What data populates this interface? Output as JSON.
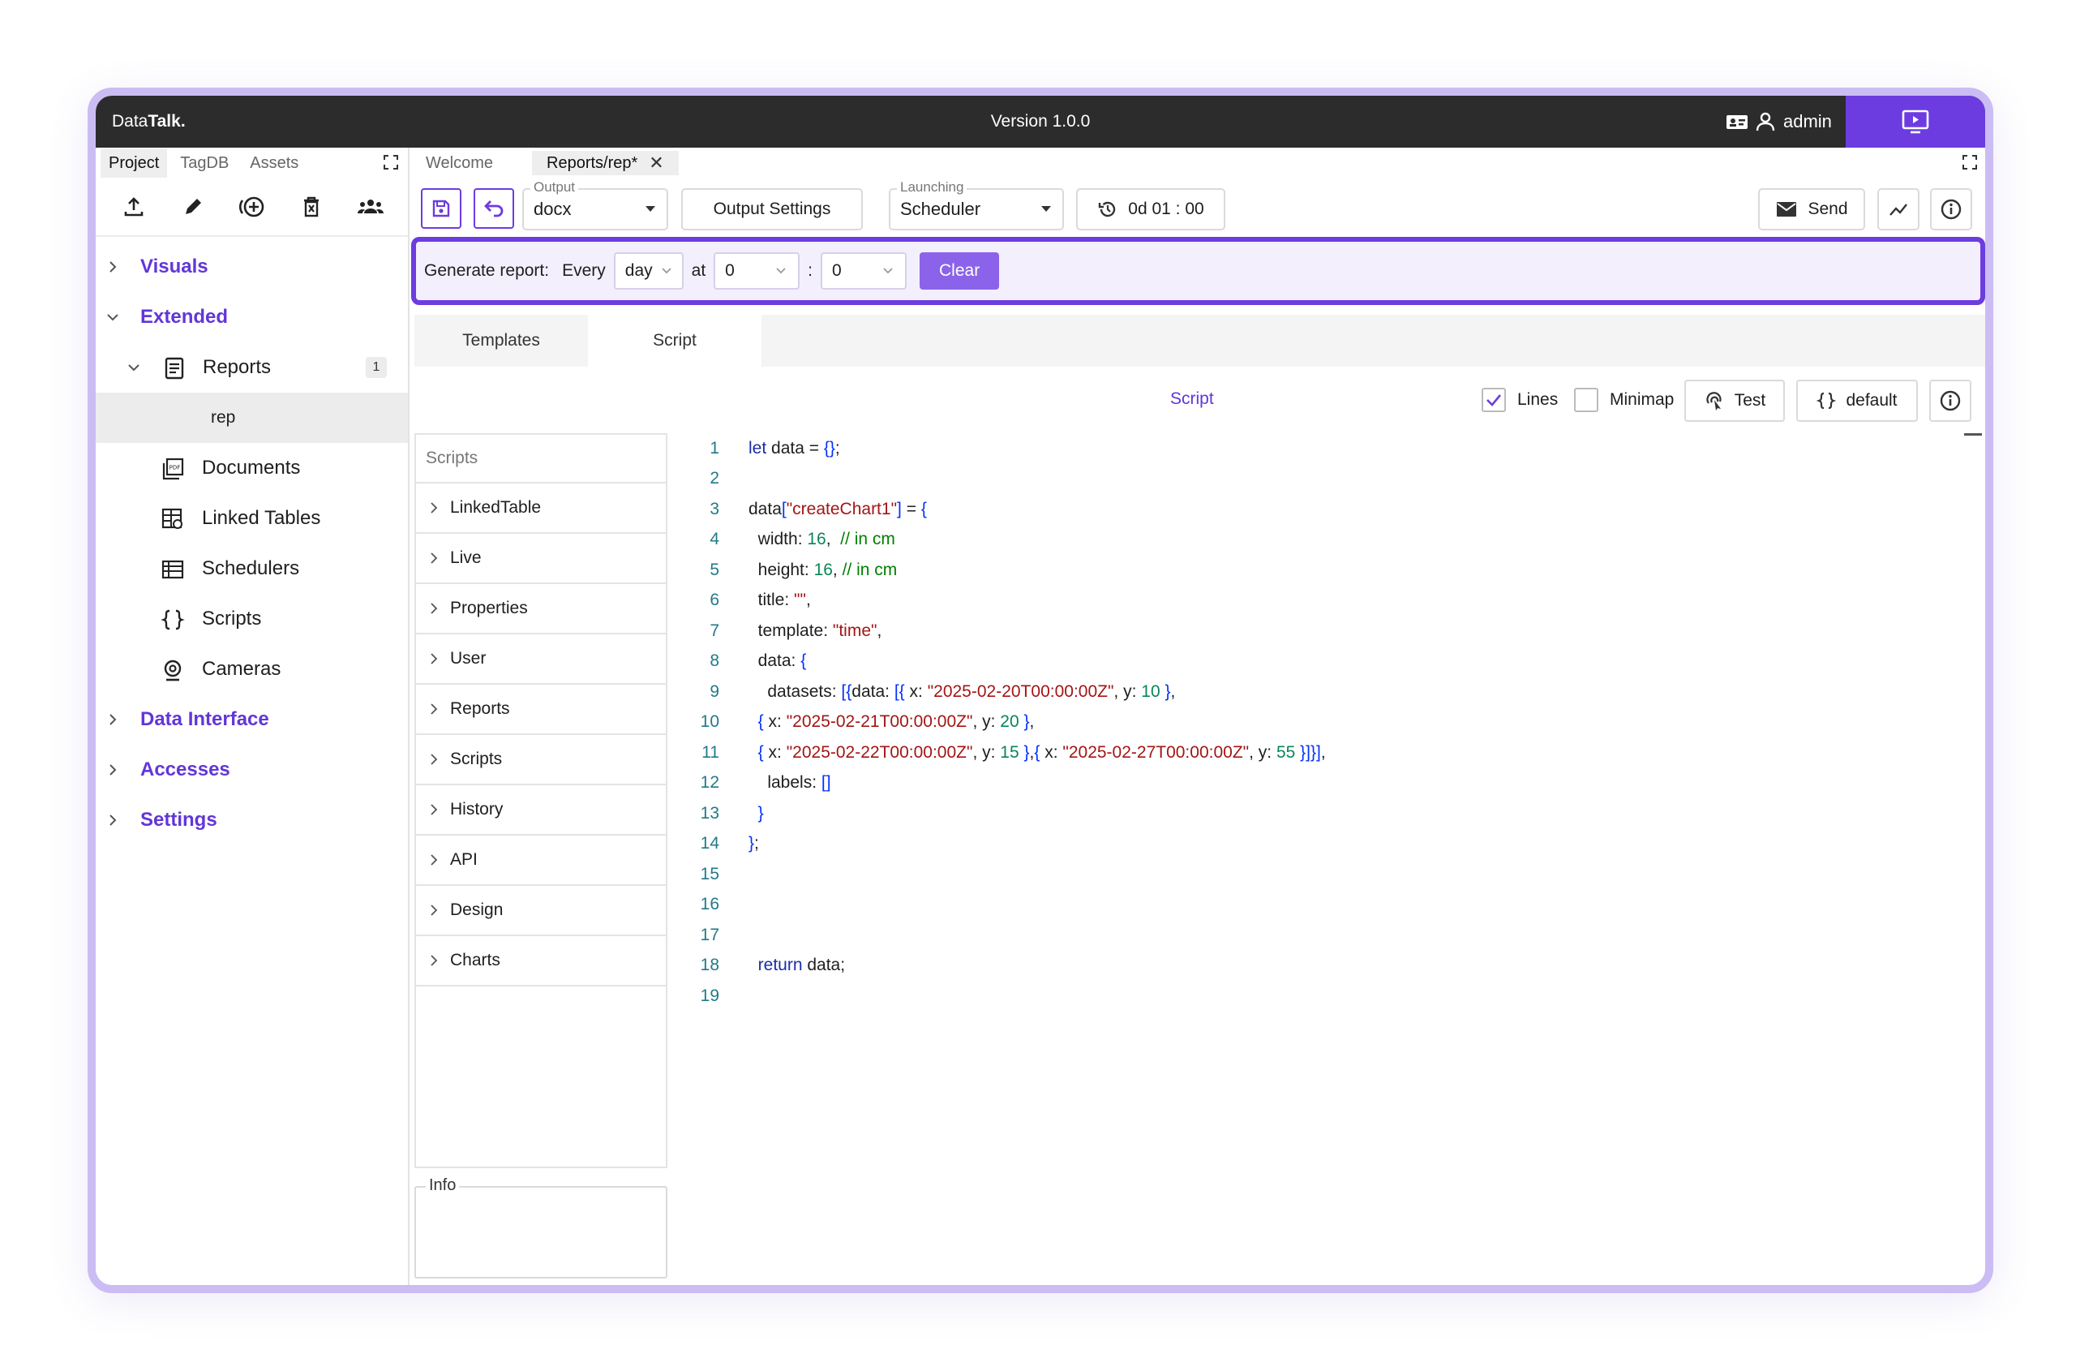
{
  "topbar": {
    "brand_light": "Data",
    "brand_bold": "Talk.",
    "version": "Version 1.0.0",
    "user": "admin",
    "accent": "#6c3ce0"
  },
  "left": {
    "tabs": [
      "Project",
      "TagDB",
      "Assets"
    ],
    "toolbar_icons": [
      "upload-icon",
      "pencil-icon",
      "add-circle-icon",
      "delete-icon",
      "group-icon"
    ],
    "tree": {
      "visuals": "Visuals",
      "extended": "Extended",
      "reports": "Reports",
      "reports_badge": "1",
      "rep": "rep",
      "documents": "Documents",
      "linked_tables": "Linked Tables",
      "schedulers": "Schedulers",
      "scripts": "Scripts",
      "cameras": "Cameras",
      "data_interface": "Data Interface",
      "accesses": "Accesses",
      "settings": "Settings"
    }
  },
  "main": {
    "tabs": {
      "welcome": "Welcome",
      "active": "Reports/rep*"
    },
    "toolbar": {
      "output_legend": "Output",
      "output_value": "docx",
      "output_settings": "Output Settings",
      "launching_legend": "Launching",
      "launching_value": "Scheduler",
      "timer": "0d 01 : 00",
      "send": "Send"
    },
    "generate": {
      "label": "Generate report:",
      "every": "Every",
      "period": "day",
      "at": "at",
      "hour": "0",
      "sep": ":",
      "minute": "0",
      "clear": "Clear"
    },
    "view_tabs": [
      "Templates",
      "Script"
    ],
    "script_header": {
      "title": "Script",
      "lines": "Lines",
      "minimap": "Minimap",
      "test": "Test",
      "default": "default"
    },
    "scripts_panel": {
      "placeholder": "Scripts",
      "items": [
        "LinkedTable",
        "Live",
        "Properties",
        "User",
        "Reports",
        "Scripts",
        "History",
        "API",
        "Design",
        "Charts"
      ],
      "info": "Info"
    },
    "editor": {
      "line_numbers": [
        "1",
        "2",
        "3",
        "4",
        "5",
        "6",
        "7",
        "8",
        "9",
        "10",
        "11",
        "12",
        "13",
        "14",
        "15",
        "16",
        "17",
        "18",
        "19"
      ],
      "lines": [
        "let data = {};",
        "",
        "data[\"createChart1\"] = {",
        "  width: 16,  // in cm",
        "  height: 16, // in cm",
        "  title: \"\",",
        "  template: \"time\",",
        "  data: {",
        "    datasets: [{data: [{ x: \"2025-02-20T00:00:00Z\", y: 10 },",
        "  { x: \"2025-02-21T00:00:00Z\", y: 20 },",
        "  { x: \"2025-02-22T00:00:00Z\", y: 15 },{ x: \"2025-02-27T00:00:00Z\", y: 55 }]}],",
        "    labels: []",
        "  }",
        "};",
        "",
        "",
        "",
        "  return data;",
        ""
      ]
    }
  }
}
